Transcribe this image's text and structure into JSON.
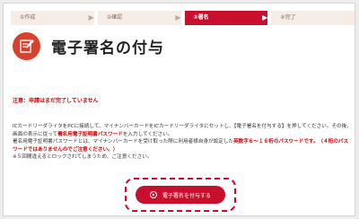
{
  "steps": [
    {
      "label": "①作成",
      "arrow": "▶"
    },
    {
      "label": "②確認",
      "arrow": "▶"
    },
    {
      "label": "③署名",
      "arrow": "▶"
    },
    {
      "label": "④完了",
      "arrow": ""
    }
  ],
  "active_step": 3,
  "page_title": "電子署名の付与",
  "warning": "注意：申請はまだ完了していません",
  "body": {
    "p1a": "ICカードリーダライタをPCに接続して、マイナンバーカードをICカードリーダライタにセットし、【電子署名を付与する】を押してください。その後、画面の表示に従って",
    "p1b": "署名用電子証明書パスワード",
    "p1c": "を入力してください。",
    "p2a": "署名用電子証明書パスワードとは、マイナンバーカードを受け取った際に利用者様自身が設定した",
    "p2b": "英数字６～１６桁のパスワードです。（４桁のパスワードではありませんのでご注意ください。）",
    "p3": "※５回間違えるとロックされてしまうため、ご注意ください。"
  },
  "button_label": "電子署名を付与する",
  "colors": {
    "accent": "#c8102e",
    "icon_bg": "#d9412e",
    "warning": "#d40000"
  }
}
